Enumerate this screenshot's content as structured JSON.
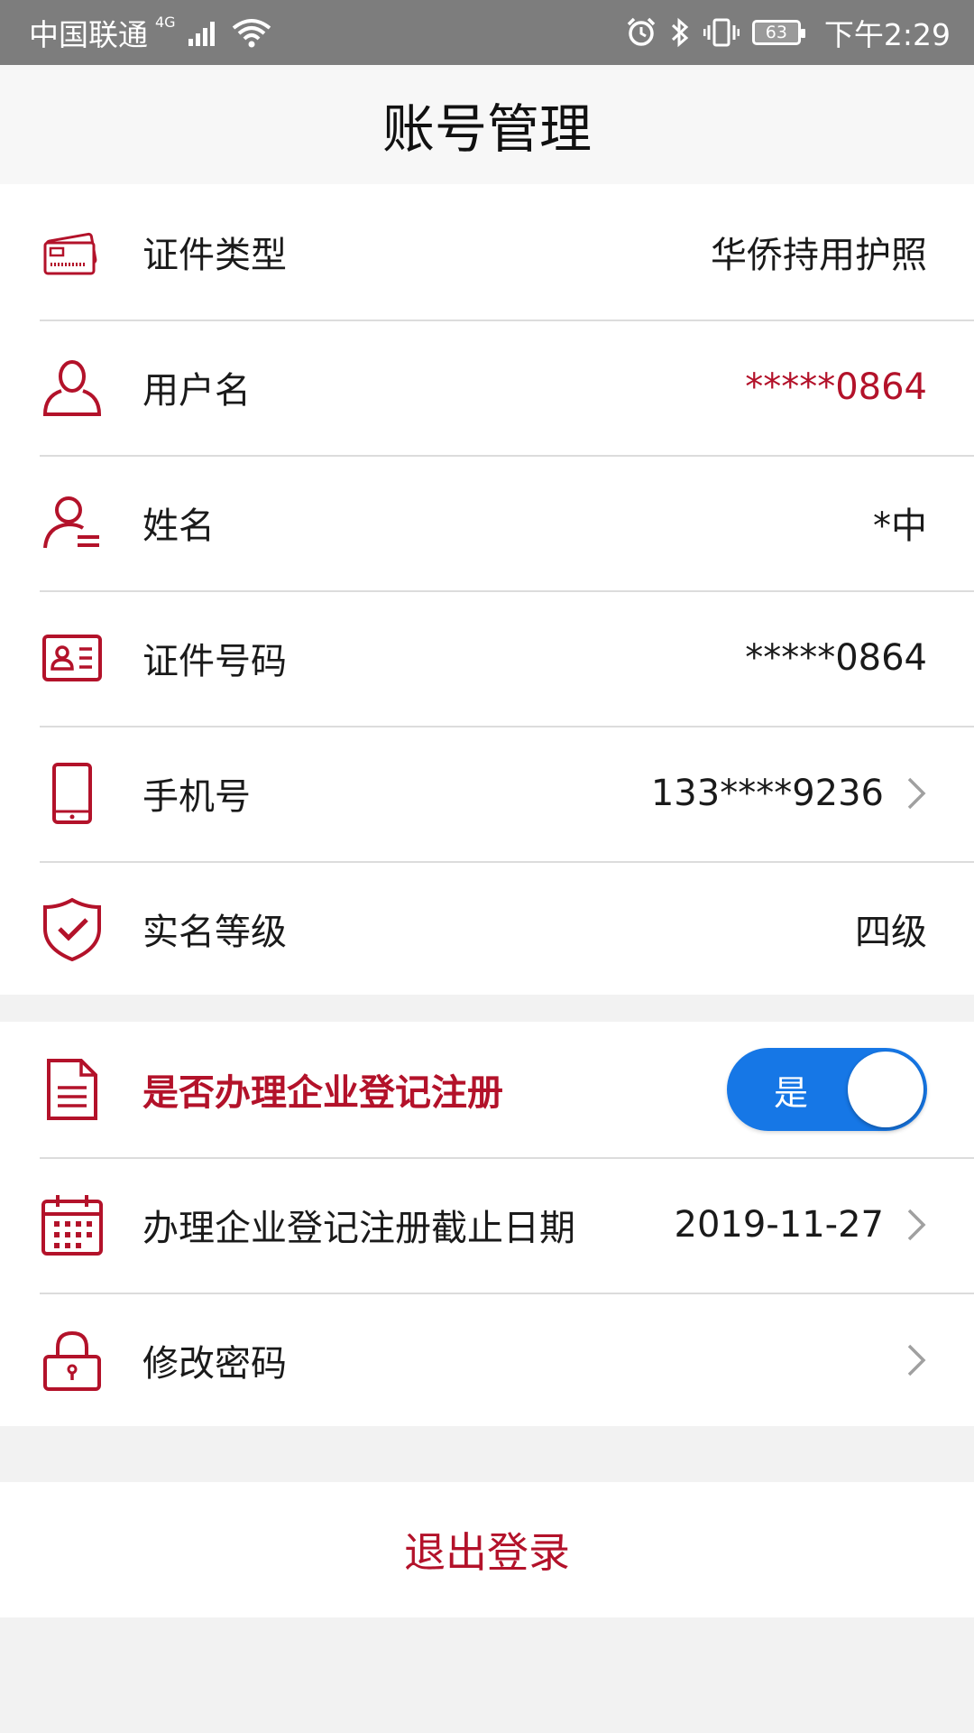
{
  "status_bar": {
    "carrier": "中国联通",
    "network": "4G",
    "battery": "63",
    "time": "下午2:29"
  },
  "header": {
    "title": "账号管理"
  },
  "account": {
    "doc_type": {
      "label": "证件类型",
      "value": "华侨持用护照",
      "icon": "card-icon"
    },
    "username": {
      "label": "用户名",
      "value": "*****0864",
      "icon": "user-icon"
    },
    "name": {
      "label": "姓名",
      "value": "*中",
      "icon": "user-list-icon"
    },
    "id_number": {
      "label": "证件号码",
      "value": "*****0864",
      "icon": "id-card-icon"
    },
    "phone": {
      "label": "手机号",
      "value": "133****9236",
      "icon": "phone-icon"
    },
    "realname_level": {
      "label": "实名等级",
      "value": "四级",
      "icon": "shield-check-icon"
    }
  },
  "enterprise": {
    "register": {
      "label": "是否办理企业登记注册",
      "toggle_label": "是",
      "toggle_on": true,
      "icon": "document-icon"
    },
    "deadline": {
      "label": "办理企业登记注册截止日期",
      "value": "2019-11-27",
      "icon": "calendar-icon"
    },
    "password": {
      "label": "修改密码",
      "icon": "lock-icon"
    }
  },
  "actions": {
    "logout_label": "退出登录"
  },
  "colors": {
    "accent": "#b3122a",
    "toggle": "#1677e6",
    "status_bar": "#7d7d7d"
  }
}
